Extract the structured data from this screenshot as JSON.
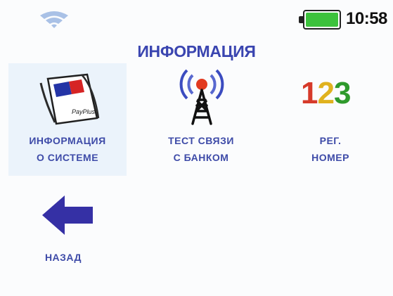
{
  "status": {
    "time": "10:58",
    "wifi_icon": "wifi-icon",
    "battery_icon": "battery-full-icon",
    "battery_color": "#3cc23c"
  },
  "title": "ИНФОРМАЦИЯ",
  "menu": {
    "system_info": {
      "label": "ИНФОРМАЦИЯ\nО СИСТЕМЕ",
      "icon": "payplus-card-icon",
      "brand": "PayPlus"
    },
    "bank_test": {
      "label": "ТЕСТ СВЯЗИ\nС БАНКОМ",
      "icon": "antenna-tower-icon"
    },
    "reg_number": {
      "label": "РЕГ.\nНОМЕР",
      "icon": "number-123-icon",
      "digits": [
        "1",
        "2",
        "3"
      ],
      "digit_colors": [
        "#d63a2a",
        "#e0b21e",
        "#2f9a2c"
      ]
    },
    "back": {
      "label": "НАЗАД",
      "icon": "arrow-left-icon",
      "color": "#3530a5"
    }
  },
  "colors": {
    "accent": "#3a45b0",
    "label": "#3e4ba8",
    "selected_bg": "#ebf3fb"
  }
}
